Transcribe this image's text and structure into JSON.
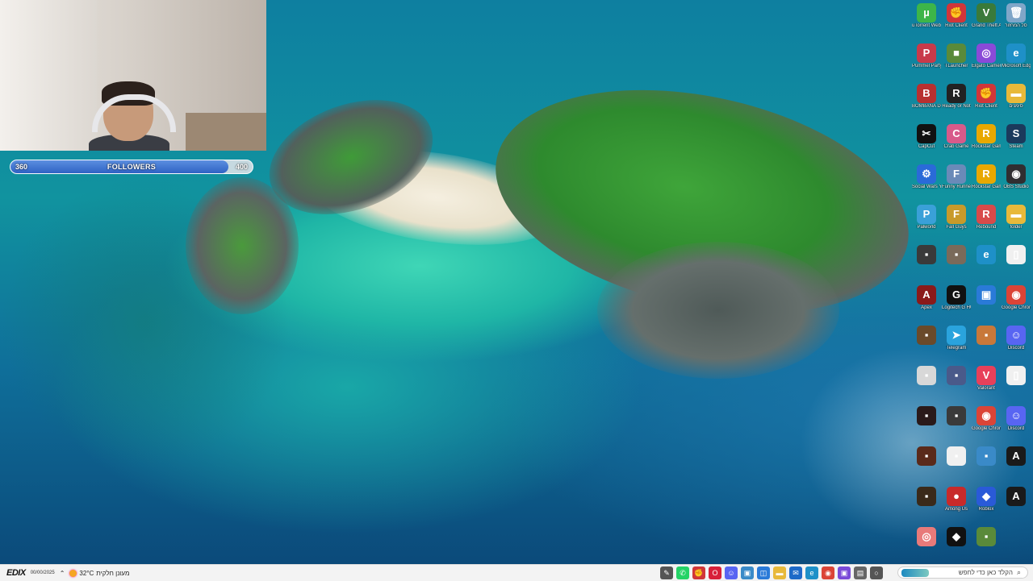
{
  "stream_overlay": {
    "follower_goal": {
      "current": "360",
      "label": "FOLLOWERS",
      "target": "400",
      "progress_fraction": 0.9,
      "fill_color": "#2f62c4"
    }
  },
  "desktop": {
    "icons": [
      {
        "label": "uTorrent Web",
        "icon": "utorrent-icon",
        "color": "#3db549",
        "glyph": "µ"
      },
      {
        "label": "Riot Client",
        "icon": "riot-icon",
        "color": "#d13639",
        "glyph": "✊"
      },
      {
        "label": "Grand Theft Auto V Le...",
        "icon": "gta-icon",
        "color": "#3a7a3a",
        "glyph": "V"
      },
      {
        "label": "סל המחזור",
        "icon": "recycle-bin-icon",
        "color": "#7fa6c8",
        "glyph": "🗑"
      },
      {
        "label": "Pummel Party",
        "icon": "pummel-party-icon",
        "color": "#c83a4a",
        "glyph": "P"
      },
      {
        "label": "TLauncher",
        "icon": "tlauncher-icon",
        "color": "#5a8a3a",
        "glyph": "■"
      },
      {
        "label": "Elgato Camera Hub",
        "icon": "elgato-icon",
        "color": "#8a4ad8",
        "glyph": "◎"
      },
      {
        "label": "Microsoft Edge",
        "icon": "edge-icon",
        "color": "#1e90c8",
        "glyph": "e"
      },
      {
        "label": "BOMBANA Demo",
        "icon": "bombana-icon",
        "color": "#b83030",
        "glyph": "B"
      },
      {
        "label": "Ready or Not",
        "icon": "ready-or-not-icon",
        "color": "#222222",
        "glyph": "R"
      },
      {
        "label": "Riot Client",
        "icon": "riot-icon",
        "color": "#d13639",
        "glyph": "✊"
      },
      {
        "label": "סימנים",
        "icon": "folder-icon",
        "color": "#e8b93a",
        "glyph": "▬"
      },
      {
        "label": "CapCut",
        "icon": "capcut-icon",
        "color": "#111111",
        "glyph": "✂"
      },
      {
        "label": "Crab Game",
        "icon": "crab-game-icon",
        "color": "#d85a8a",
        "glyph": "C"
      },
      {
        "label": "Rockstar Games L...",
        "icon": "rockstar-icon",
        "color": "#e8a800",
        "glyph": "R"
      },
      {
        "label": "Steam",
        "icon": "steam-icon",
        "color": "#1b3a5c",
        "glyph": "S"
      },
      {
        "label": "Social Wars Your Friends",
        "icon": "game-icon",
        "color": "#2a6ad8",
        "glyph": "⚙"
      },
      {
        "label": "Funny Runners",
        "icon": "game-icon",
        "color": "#6a8ab8",
        "glyph": "F"
      },
      {
        "label": "Rockstar Games L...",
        "icon": "rockstar-icon",
        "color": "#e8a800",
        "glyph": "R"
      },
      {
        "label": "OBS Studio",
        "icon": "obs-icon",
        "color": "#302e31",
        "glyph": "◉"
      },
      {
        "label": "Palworld",
        "icon": "palworld-icon",
        "color": "#3aa0d8",
        "glyph": "P"
      },
      {
        "label": "Fall Guys",
        "icon": "fall-guys-icon",
        "color": "#c89a2a",
        "glyph": "F"
      },
      {
        "label": "Rebound",
        "icon": "game-icon",
        "color": "#d84a4a",
        "glyph": "R"
      },
      {
        "label": "folder",
        "icon": "folder-icon",
        "color": "#e8b93a",
        "glyph": "▬"
      },
      {
        "label": "",
        "icon": "game-icon",
        "color": "#3a3a3a",
        "glyph": "▪"
      },
      {
        "label": "",
        "icon": "game-icon",
        "color": "#7a6a5a",
        "glyph": "▪"
      },
      {
        "label": "",
        "icon": "edge-icon",
        "color": "#1e90c8",
        "glyph": "e"
      },
      {
        "label": "",
        "icon": "document-icon",
        "color": "#f0f0f0",
        "glyph": "▯"
      },
      {
        "label": "Apex",
        "icon": "game-icon",
        "color": "#8a1a1a",
        "glyph": "A"
      },
      {
        "label": "Logitech G HUB",
        "icon": "logitech-icon",
        "color": "#111111",
        "glyph": "G"
      },
      {
        "label": "",
        "icon": "app-icon",
        "color": "#2a7ad8",
        "glyph": "▣"
      },
      {
        "label": "Google Chrome",
        "icon": "chrome-icon",
        "color": "#db4437",
        "glyph": "◉"
      },
      {
        "label": "",
        "icon": "game-icon",
        "color": "#6a4a2a",
        "glyph": "▪"
      },
      {
        "label": "Telegram",
        "icon": "telegram-icon",
        "color": "#2aa3dd",
        "glyph": "➤"
      },
      {
        "label": "",
        "icon": "game-icon",
        "color": "#c8783a",
        "glyph": "▪"
      },
      {
        "label": "Discord",
        "icon": "discord-icon",
        "color": "#5865f2",
        "glyph": "☺"
      },
      {
        "label": "",
        "icon": "game-icon",
        "color": "#d8d8d8",
        "glyph": "▪"
      },
      {
        "label": "",
        "icon": "game-icon",
        "color": "#4a5a8a",
        "glyph": "▪"
      },
      {
        "label": "Valorant",
        "icon": "valorant-icon",
        "color": "#e8405a",
        "glyph": "V"
      },
      {
        "label": "",
        "icon": "document-icon",
        "color": "#f0f0f0",
        "glyph": "▯"
      },
      {
        "label": "",
        "icon": "game-icon",
        "color": "#2a1a1a",
        "glyph": "▪"
      },
      {
        "label": "",
        "icon": "game-icon",
        "color": "#3a3a3a",
        "glyph": "▪"
      },
      {
        "label": "Google Chrome",
        "icon": "chrome-icon",
        "color": "#db4437",
        "glyph": "◉"
      },
      {
        "label": "Discord",
        "icon": "discord-icon",
        "color": "#5865f2",
        "glyph": "☺"
      },
      {
        "label": "",
        "icon": "game-icon",
        "color": "#5a2a1a",
        "glyph": "▪"
      },
      {
        "label": "",
        "icon": "game-icon",
        "color": "#f0f0f0",
        "glyph": "▪"
      },
      {
        "label": "",
        "icon": "game-icon",
        "color": "#3a8ac8",
        "glyph": "▪"
      },
      {
        "label": "",
        "icon": "game-icon",
        "color": "#1a1a1a",
        "glyph": "A"
      },
      {
        "label": "",
        "icon": "game-icon",
        "color": "#3a2a1a",
        "glyph": "▪"
      },
      {
        "label": "Among Us",
        "icon": "among-us-icon",
        "color": "#c82a2a",
        "glyph": "●"
      },
      {
        "label": "Roblox",
        "icon": "roblox-icon",
        "color": "#2a5ad8",
        "glyph": "◆"
      },
      {
        "label": "",
        "icon": "game-icon",
        "color": "#1a1a1a",
        "glyph": "A"
      },
      {
        "label": "",
        "icon": "app-icon",
        "color": "#e87a7a",
        "glyph": "◎"
      },
      {
        "label": "",
        "icon": "roblox-studio-icon",
        "color": "#111111",
        "glyph": "◆"
      },
      {
        "label": "",
        "icon": "game-icon",
        "color": "#5a8a3a",
        "glyph": "▪"
      }
    ]
  },
  "taskbar": {
    "brand": "EDIX",
    "brand_small": "00/00/2025",
    "weather_temp": "32°C",
    "weather_text": "מעונן חלקית",
    "search_placeholder": "הקלד כאן כדי לחפש",
    "apps": [
      {
        "icon": "pen-icon",
        "color": "#555555",
        "glyph": "✎"
      },
      {
        "icon": "whatsapp-icon",
        "color": "#25d366",
        "glyph": "✆"
      },
      {
        "icon": "riot-icon",
        "color": "#d13639",
        "glyph": "✊"
      },
      {
        "icon": "opera-icon",
        "color": "#d8203a",
        "glyph": "O"
      },
      {
        "icon": "discord-icon",
        "color": "#5865f2",
        "glyph": "☺"
      },
      {
        "icon": "app-icon",
        "color": "#3a8ac8",
        "glyph": "▣"
      },
      {
        "icon": "store-icon",
        "color": "#2a7ad8",
        "glyph": "◫"
      },
      {
        "icon": "file-explorer-icon",
        "color": "#e8b93a",
        "glyph": "▬"
      },
      {
        "icon": "mail-icon",
        "color": "#1e6ac8",
        "glyph": "✉"
      },
      {
        "icon": "edge-icon",
        "color": "#1e90c8",
        "glyph": "e"
      },
      {
        "icon": "chrome-icon",
        "color": "#db4437",
        "glyph": "◉"
      },
      {
        "icon": "app-icon",
        "color": "#7a4ad8",
        "glyph": "▣"
      },
      {
        "icon": "task-view-icon",
        "color": "#666666",
        "glyph": "▤"
      },
      {
        "icon": "cortana-icon",
        "color": "#555555",
        "glyph": "○"
      }
    ]
  }
}
